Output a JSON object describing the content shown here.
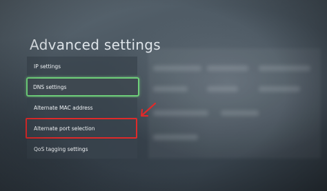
{
  "page": {
    "title": "Advanced settings"
  },
  "menu": {
    "items": [
      {
        "label": "IP settings"
      },
      {
        "label": "DNS settings"
      },
      {
        "label": "Alternate MAC address"
      },
      {
        "label": "Alternate port selection"
      },
      {
        "label": "QoS tagging settings"
      }
    ],
    "focused_label": "DNS settings"
  },
  "annotation": {
    "highlighted_label": "Alternate port selection",
    "highlight_color": "#e02a2a",
    "focus_color": "#6fd07a",
    "arrow_icon": "red-arrow-icon"
  },
  "colors": {
    "background": "#3b4650",
    "text": "#f2f5f7"
  }
}
